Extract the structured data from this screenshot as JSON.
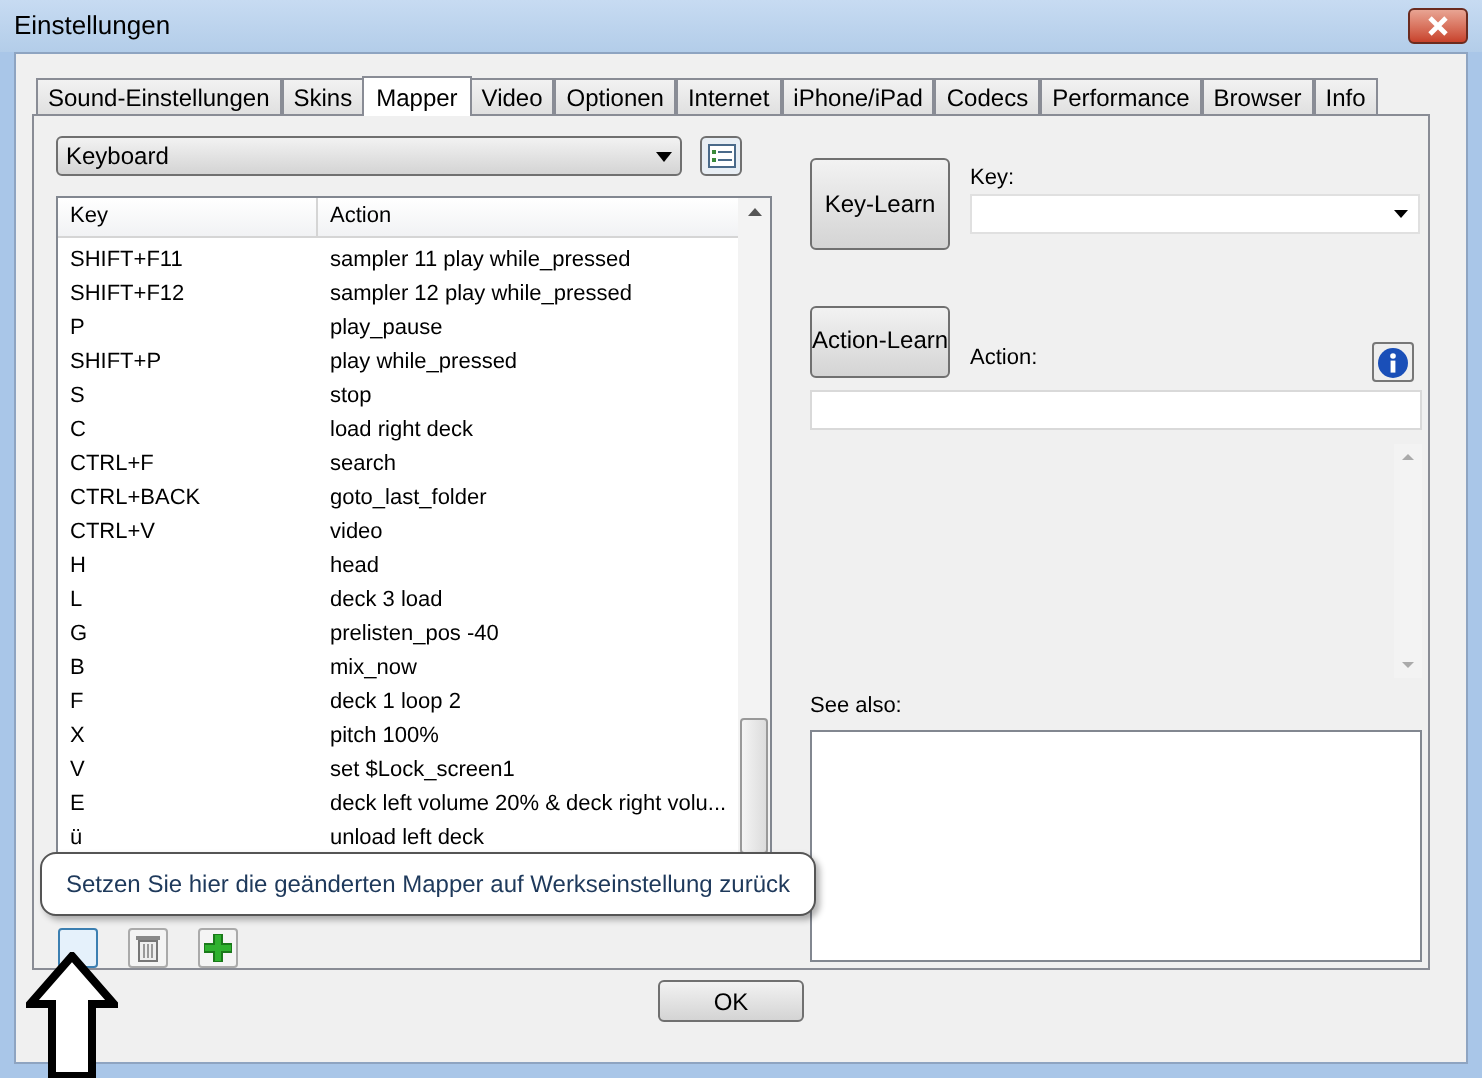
{
  "window": {
    "title": "Einstellungen"
  },
  "tabs": [
    {
      "label": "Sound-Einstellungen",
      "selected": false
    },
    {
      "label": "Skins",
      "selected": false
    },
    {
      "label": "Mapper",
      "selected": true
    },
    {
      "label": "Video",
      "selected": false
    },
    {
      "label": "Optionen",
      "selected": false
    },
    {
      "label": "Internet",
      "selected": false
    },
    {
      "label": "iPhone/iPad",
      "selected": false
    },
    {
      "label": "Codecs",
      "selected": false
    },
    {
      "label": "Performance",
      "selected": false
    },
    {
      "label": "Browser",
      "selected": false
    },
    {
      "label": "Info",
      "selected": false
    }
  ],
  "mapper_select": {
    "value": "Keyboard"
  },
  "table": {
    "columns": [
      "Key",
      "Action"
    ],
    "rows": [
      [
        "SHIFT+F11",
        "sampler 11 play while_pressed"
      ],
      [
        "SHIFT+F12",
        "sampler 12 play while_pressed"
      ],
      [
        "P",
        "play_pause"
      ],
      [
        "SHIFT+P",
        "play while_pressed"
      ],
      [
        "S",
        "stop"
      ],
      [
        "C",
        "load right deck"
      ],
      [
        "CTRL+F",
        "search"
      ],
      [
        "CTRL+BACK",
        "goto_last_folder"
      ],
      [
        "CTRL+V",
        "video"
      ],
      [
        "H",
        "head"
      ],
      [
        "L",
        "deck 3 load"
      ],
      [
        "G",
        "prelisten_pos -40"
      ],
      [
        "B",
        "mix_now"
      ],
      [
        "F",
        "deck 1 loop 2"
      ],
      [
        "X",
        "pitch 100%"
      ],
      [
        "V",
        "set $Lock_screen1"
      ],
      [
        "E",
        "deck left volume 20% & deck right volu..."
      ],
      [
        "ü",
        "unload left deck"
      ]
    ]
  },
  "tooltip": "Setzen Sie hier die geänderten Mapper auf Werkseinstellung zurück",
  "key_learn_button": "Key-Learn",
  "key_label": "Key:",
  "action_learn_button": "Action-Learn",
  "action_label": "Action:",
  "see_also_label": "See also:",
  "ok_button": "OK"
}
